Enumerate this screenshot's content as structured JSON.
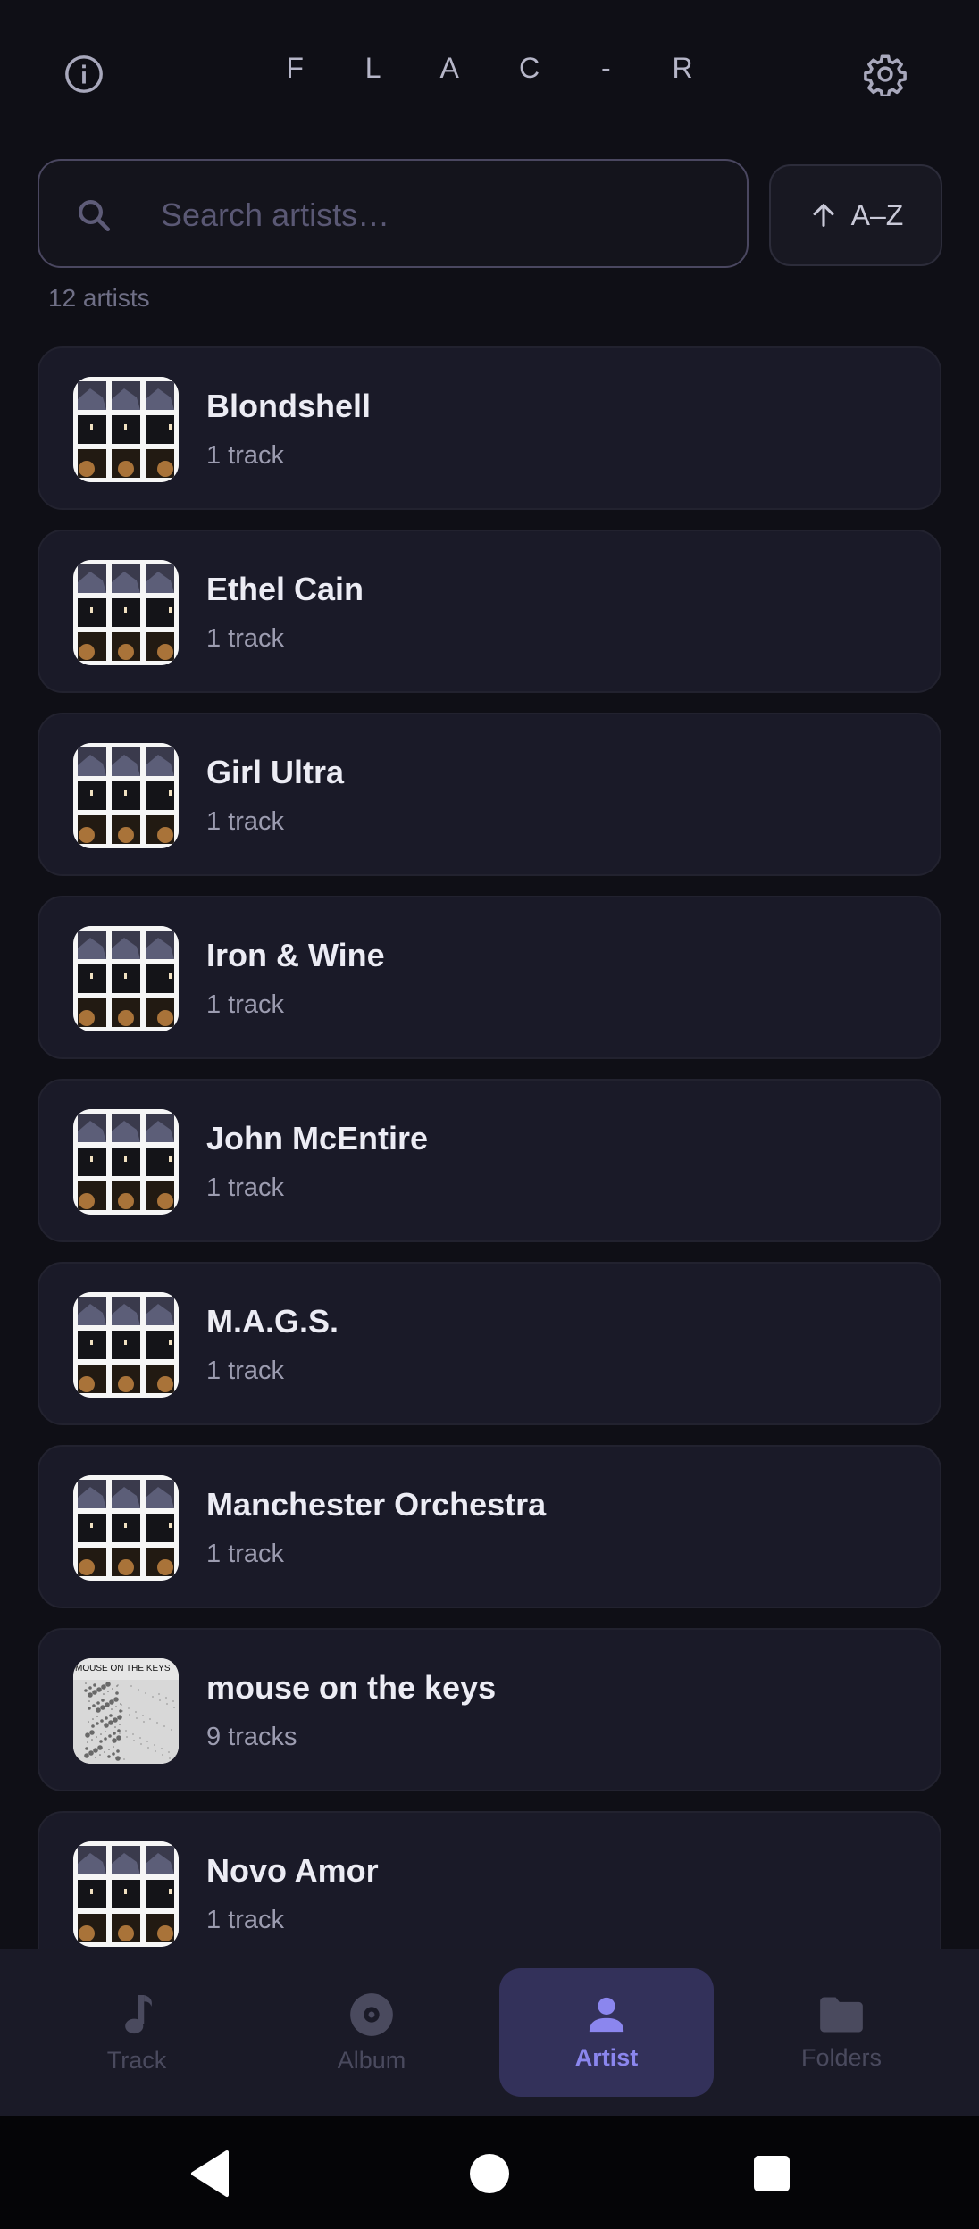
{
  "header": {
    "title": "F L A C - R",
    "info_icon": "info-icon",
    "settings_icon": "gear-icon"
  },
  "search": {
    "placeholder": "Search artists…",
    "value": ""
  },
  "sort": {
    "label": "A–Z",
    "icon": "arrow-up-icon"
  },
  "count_label": "12 artists",
  "artists": [
    {
      "name": "Blondshell",
      "tracks": "1 track",
      "thumb": "grid"
    },
    {
      "name": "Ethel Cain",
      "tracks": "1 track",
      "thumb": "grid"
    },
    {
      "name": "Girl Ultra",
      "tracks": "1 track",
      "thumb": "grid"
    },
    {
      "name": "Iron & Wine",
      "tracks": "1 track",
      "thumb": "grid"
    },
    {
      "name": "John McEntire",
      "tracks": "1 track",
      "thumb": "grid"
    },
    {
      "name": "M.A.G.S.",
      "tracks": "1 track",
      "thumb": "grid"
    },
    {
      "name": "Manchester Orchestra",
      "tracks": "1 track",
      "thumb": "grid"
    },
    {
      "name": "mouse on the keys",
      "tracks": "9 tracks",
      "thumb": "mouse",
      "thumb_text": "MOUSE ON THE KEYS"
    },
    {
      "name": "Novo Amor",
      "tracks": "1 track",
      "thumb": "grid"
    }
  ],
  "nav": [
    {
      "label": "Track",
      "icon": "music-note-icon",
      "active": false
    },
    {
      "label": "Album",
      "icon": "disc-icon",
      "active": false
    },
    {
      "label": "Artist",
      "icon": "person-icon",
      "active": true
    },
    {
      "label": "Folders",
      "icon": "folder-icon",
      "active": false
    }
  ],
  "colors": {
    "background": "#0f0f16",
    "card": "#1a1a28",
    "accent": "#8b86ee",
    "nav_active_bg": "#33315a"
  }
}
